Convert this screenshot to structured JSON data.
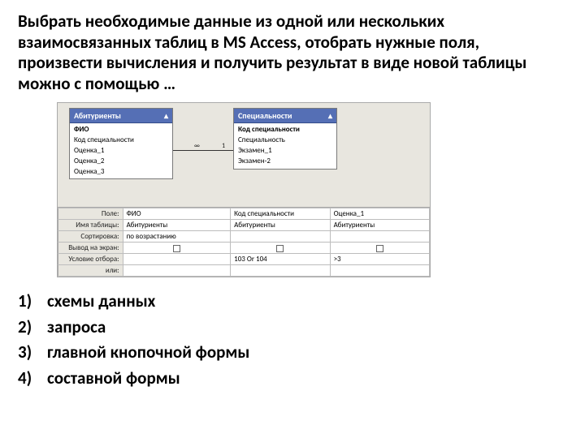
{
  "question": "Выбрать необходимые данные из одной или нескольких взаимосвязанных таблиц в MS Access, отобрать нужные поля, произвести вычисления и получить результат в виде новой таблицы можно с помощью …",
  "diagram": {
    "table1": {
      "title": "Абитуриенты",
      "fields": [
        "ФИО",
        "Код специальности",
        "Оценка_1",
        "Оценка_2",
        "Оценка_3"
      ],
      "bold_index": 0
    },
    "table2": {
      "title": "Специальности",
      "fields": [
        "Код специальности",
        "Специальность",
        "Экзамен_1",
        "Экзамен-2"
      ],
      "bold_index": 0
    },
    "relation": {
      "left": "∞",
      "right": "1"
    }
  },
  "qbe": {
    "row_labels": [
      "Поле:",
      "Имя таблицы:",
      "Сортировка:",
      "Вывод на экран:",
      "Условие отбора:",
      "или:"
    ],
    "cols": [
      {
        "field": "ФИО",
        "table": "Абитуриенты",
        "sort": "по возрастанию",
        "criteria": ""
      },
      {
        "field": "Код специальности",
        "table": "Абитуриенты",
        "sort": "",
        "criteria": "103 Or 104"
      },
      {
        "field": "Оценка_1",
        "table": "Абитуриенты",
        "sort": "",
        "criteria": ">3"
      }
    ]
  },
  "answers": [
    {
      "num": "1)",
      "text": "схемы данных"
    },
    {
      "num": "2)",
      "text": "запроса"
    },
    {
      "num": "3)",
      "text": "главной кнопочной формы"
    },
    {
      "num": "4)",
      "text": "составной формы"
    }
  ]
}
